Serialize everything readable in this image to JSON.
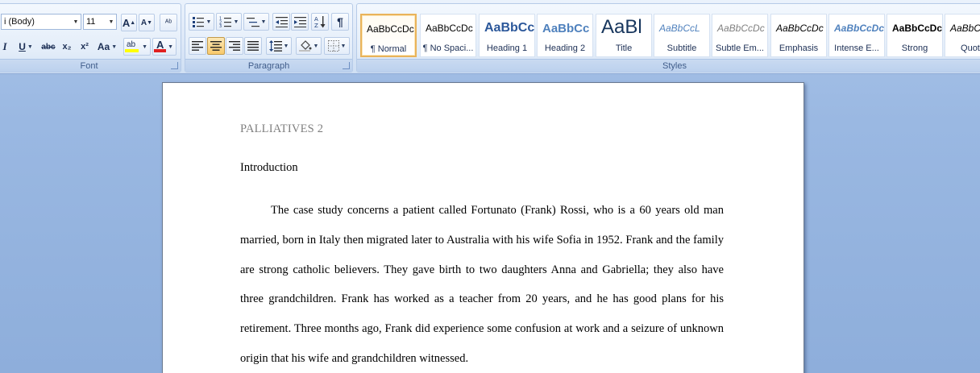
{
  "ribbon": {
    "font": {
      "label": "Font",
      "font_name": "i (Body)",
      "font_size": "11",
      "grow_label": "A",
      "shrink_label": "A",
      "clear_label": "ᴬᵇ",
      "italic_label": "I",
      "underline_label": "U",
      "strike_label": "abc",
      "subscript_label": "x₂",
      "superscript_label": "x²",
      "case_label": "Aa",
      "highlight_label": "ab",
      "font_color_label": "A",
      "highlight_color": "#ffff00",
      "font_color": "#e02020"
    },
    "paragraph": {
      "label": "Paragraph"
    },
    "styles": {
      "label": "Styles",
      "items": [
        {
          "sample": "AaBbCcDc",
          "name": "¶ Normal"
        },
        {
          "sample": "AaBbCcDc",
          "name": "¶ No Spaci..."
        },
        {
          "sample": "AaBbCc",
          "name": "Heading 1"
        },
        {
          "sample": "AaBbCc",
          "name": "Heading 2"
        },
        {
          "sample": "AaBl",
          "name": "Title"
        },
        {
          "sample": "AaBbCcL",
          "name": "Subtitle"
        },
        {
          "sample": "AaBbCcDc",
          "name": "Subtle Em..."
        },
        {
          "sample": "AaBbCcDc",
          "name": "Emphasis"
        },
        {
          "sample": "AaBbCcDc",
          "name": "Intense E..."
        },
        {
          "sample": "AaBbCcDc",
          "name": "Strong"
        },
        {
          "sample": "AaBbCc",
          "name": "Quote"
        }
      ]
    }
  },
  "document": {
    "header": "PALLIATIVES 2",
    "heading": "Introduction",
    "paragraph": "The case study concerns a patient called Fortunato (Frank) Rossi, who is a 60 years old man married, born in Italy then migrated later to Australia with his wife Sofia in 1952. Frank and the family are strong catholic believers. They gave birth to two daughters Anna and Gabriella; they also have three grandchildren. Frank has worked as a teacher from 20 years, and he has good plans for his retirement. Three months ago, Frank did experience some confusion at work and a seizure of unknown origin that his wife and grandchildren witnessed."
  }
}
